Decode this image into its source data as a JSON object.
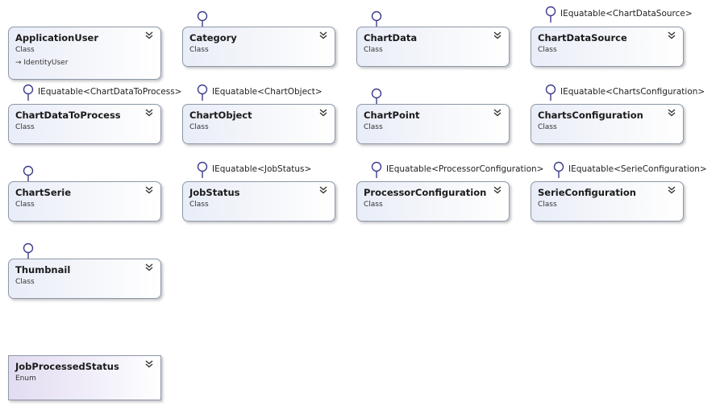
{
  "shapes": [
    {
      "name": "ApplicationUser",
      "kind": "Class",
      "base": "IdentityUser"
    },
    {
      "name": "Category",
      "kind": "Class"
    },
    {
      "name": "ChartData",
      "kind": "Class"
    },
    {
      "name": "ChartDataSource",
      "kind": "Class",
      "interface": "IEquatable<ChartDataSource>"
    },
    {
      "name": "ChartDataToProcess",
      "kind": "Class",
      "interface": "IEquatable<ChartDataToProcess>"
    },
    {
      "name": "ChartObject",
      "kind": "Class",
      "interface": "IEquatable<ChartObject>"
    },
    {
      "name": "ChartPoint",
      "kind": "Class"
    },
    {
      "name": "ChartsConfiguration",
      "kind": "Class",
      "interface": "IEquatable<ChartsConfiguration>"
    },
    {
      "name": "ChartSerie",
      "kind": "Class"
    },
    {
      "name": "JobStatus",
      "kind": "Class",
      "interface": "IEquatable<JobStatus>"
    },
    {
      "name": "ProcessorConfiguration",
      "kind": "Class",
      "interface": "IEquatable<ProcessorConfiguration>"
    },
    {
      "name": "SerieConfiguration",
      "kind": "Class",
      "interface": "IEquatable<SerieConfiguration>"
    },
    {
      "name": "Thumbnail",
      "kind": "Class"
    },
    {
      "name": "JobProcessedStatus",
      "kind": "Enum"
    }
  ],
  "icons": {
    "collapse": "double-chevron-up-icon",
    "lollipop": "interface-lollipop-icon",
    "inheritance": "inheritance-arrow-icon"
  },
  "colors": {
    "class_fill": "#e9edf8",
    "enum_fill": "#e2dcf1",
    "border": "#8e98a8",
    "connector": "#3c3c8c"
  }
}
